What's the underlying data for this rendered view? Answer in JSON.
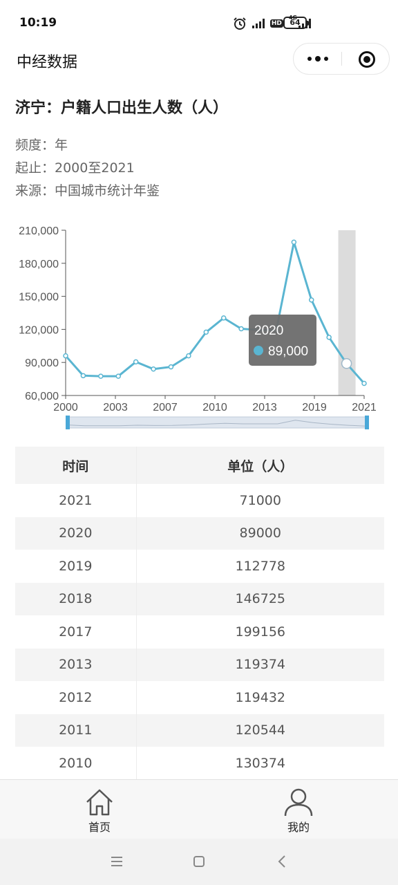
{
  "status_bar": {
    "time": "10:19",
    "network": "4G",
    "hd": "HD",
    "battery": "64",
    "icons": [
      "alarm-icon",
      "signal-icon",
      "hd-icon",
      "signal-4g-icon",
      "battery-icon"
    ]
  },
  "nav": {
    "title": "中经数据",
    "icons": [
      "more-icon",
      "close-miniprogram-icon"
    ]
  },
  "page": {
    "title": "济宁：户籍人口出生人数（人）",
    "frequency": "频度：年",
    "range": "起止：2000至2021",
    "source": "来源：中国城市统计年鉴"
  },
  "chart_data": {
    "type": "line",
    "title": "",
    "xlabel": "",
    "ylabel": "",
    "x_tick_labels": [
      "2000",
      "2003",
      "2007",
      "2010",
      "2013",
      "2019",
      "2021"
    ],
    "y_tick_labels": [
      "210,000",
      "180,000",
      "150,000",
      "120,000",
      "90,000",
      "60,000"
    ],
    "ylim": [
      60000,
      210000
    ],
    "series": [
      {
        "color": "#5ab5d1",
        "points": [
          {
            "x": 2000,
            "y": 96000
          },
          {
            "x": 2001,
            "y": 78000
          },
          {
            "x": 2002,
            "y": 77500
          },
          {
            "x": 2003,
            "y": 77500
          },
          {
            "x": 2004,
            "y": 90500
          },
          {
            "x": 2005,
            "y": 84000
          },
          {
            "x": 2006,
            "y": 86000
          },
          {
            "x": 2007,
            "y": 96000
          },
          {
            "x": 2008,
            "y": 117500
          },
          {
            "x": 2009,
            "y": 130374
          },
          {
            "x": 2010,
            "y": 120544
          },
          {
            "x": 2011,
            "y": 119432
          },
          {
            "x": 2012,
            "y": 119374
          },
          {
            "x": 2013,
            "y": 199156
          },
          {
            "x": 2014,
            "y": 146725
          },
          {
            "x": 2015,
            "y": 112778
          },
          {
            "x": 2016,
            "y": 89000
          },
          {
            "x": 2017,
            "y": 71000
          }
        ]
      }
    ],
    "tooltip": {
      "year": "2020",
      "value": "89,000",
      "point_index": 16
    },
    "highlight_band_index": 16,
    "grid": false,
    "legend": "none"
  },
  "table": {
    "headers": [
      "时间",
      "单位（人）"
    ],
    "rows": [
      [
        "2021",
        "71000"
      ],
      [
        "2020",
        "89000"
      ],
      [
        "2019",
        "112778"
      ],
      [
        "2018",
        "146725"
      ],
      [
        "2017",
        "199156"
      ],
      [
        "2013",
        "119374"
      ],
      [
        "2012",
        "119432"
      ],
      [
        "2011",
        "120544"
      ],
      [
        "2010",
        "130374"
      ]
    ]
  },
  "tabs": [
    {
      "label": "首页",
      "icon": "home-icon"
    },
    {
      "label": "我的",
      "icon": "user-icon"
    }
  ],
  "system_nav": [
    "menu-icon",
    "home-square-icon",
    "back-icon"
  ],
  "colors": {
    "line": "#5ab5d1",
    "tooltip_bg": "#6b6b6b",
    "band": "#dcdcdc",
    "zoom_handle": "#4aa8d8"
  }
}
